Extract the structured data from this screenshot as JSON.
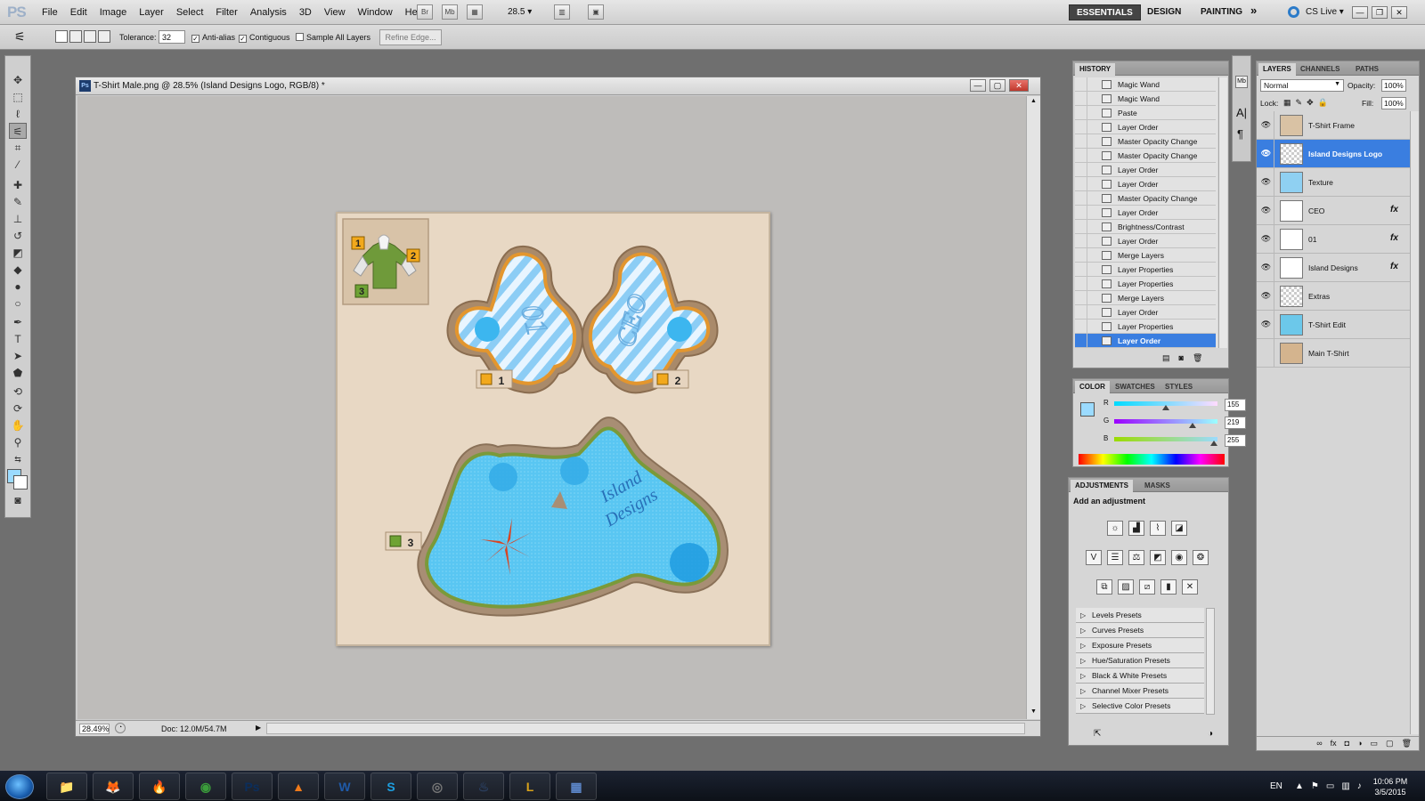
{
  "app": {
    "logo": "PS"
  },
  "menu": [
    "File",
    "Edit",
    "Image",
    "Layer",
    "Select",
    "Filter",
    "Analysis",
    "3D",
    "View",
    "Window",
    "Help"
  ],
  "menubar": {
    "icon_br": "Br",
    "icon_mb": "Mb",
    "zoom": "28.5"
  },
  "workspaces": {
    "essentials": "ESSENTIALS",
    "design": "DESIGN",
    "painting": "PAINTING",
    "more": "»",
    "cslive": "CS Live"
  },
  "options": {
    "tolerance_label": "Tolerance:",
    "tolerance_value": "32",
    "antialias": "Anti-alias",
    "contiguous": "Contiguous",
    "sample_all": "Sample All Layers",
    "refine": "Refine Edge..."
  },
  "document": {
    "title": "T-Shirt Male.png @ 28.5% (Island Designs Logo, RGB/8) *",
    "zoom_status": "28.49%",
    "doc_size": "Doc: 12.0M/54.7M"
  },
  "artwork": {
    "label_1": "1",
    "label_2": "2",
    "label_3": "3",
    "sleeve1_text": "01",
    "sleeve2_text": "CEO",
    "logo_text_1": "Island",
    "logo_text_2": "Designs"
  },
  "history": {
    "tab": "HISTORY",
    "items": [
      "Magic Wand",
      "Magic Wand",
      "Paste",
      "Layer Order",
      "Master Opacity Change",
      "Master Opacity Change",
      "Layer Order",
      "Layer Order",
      "Master Opacity Change",
      "Layer Order",
      "Brightness/Contrast",
      "Layer Order",
      "Merge Layers",
      "Layer Properties",
      "Layer Properties",
      "Merge Layers",
      "Layer Order",
      "Layer Properties",
      "Layer Order"
    ],
    "selected_index": 18
  },
  "color": {
    "tabs": [
      "COLOR",
      "SWATCHES",
      "STYLES"
    ],
    "r_label": "R",
    "g_label": "G",
    "b_label": "B",
    "r": "155",
    "g": "219",
    "b": "255",
    "fg": "#9bdbff"
  },
  "adjustments": {
    "tabs": [
      "ADJUSTMENTS",
      "MASKS"
    ],
    "heading": "Add an adjustment",
    "presets": [
      "Levels Presets",
      "Curves Presets",
      "Exposure Presets",
      "Hue/Saturation Presets",
      "Black & White Presets",
      "Channel Mixer Presets",
      "Selective Color Presets"
    ]
  },
  "layers": {
    "tabs": [
      "LAYERS",
      "CHANNELS",
      "PATHS"
    ],
    "blend_mode": "Normal",
    "opacity_label": "Opacity:",
    "opacity": "100%",
    "lock_label": "Lock:",
    "fill_label": "Fill:",
    "fill": "100%",
    "fx_symbol": "fx",
    "items": [
      {
        "name": "T-Shirt Frame",
        "visible": true,
        "fx": false
      },
      {
        "name": "Island Designs Logo",
        "visible": true,
        "fx": false,
        "selected": true
      },
      {
        "name": "Texture",
        "visible": true,
        "fx": false
      },
      {
        "name": "CEO",
        "visible": true,
        "fx": true
      },
      {
        "name": "01",
        "visible": true,
        "fx": true
      },
      {
        "name": "Island Designs",
        "visible": true,
        "fx": true
      },
      {
        "name": "Extras",
        "visible": true,
        "fx": false
      },
      {
        "name": "T-Shirt Edit",
        "visible": true,
        "fx": false
      },
      {
        "name": "Main T-Shirt",
        "visible": false,
        "fx": false
      }
    ]
  },
  "taskbar": {
    "apps": [
      "📁",
      "🦊",
      "🔥",
      "◉",
      "Ps",
      "▲",
      "W",
      "S",
      "◎",
      "♨",
      "L",
      "▦"
    ],
    "lang": "EN",
    "time": "10:06 PM",
    "date": "3/5/2015"
  }
}
